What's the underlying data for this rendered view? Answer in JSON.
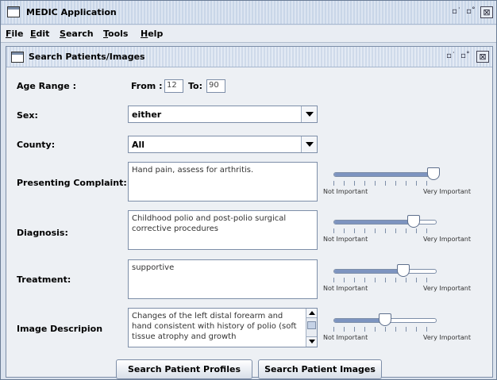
{
  "app": {
    "title": "MEDIC Application"
  },
  "menu": {
    "file": {
      "u": "F",
      "rest": "ile"
    },
    "edit": {
      "u": "E",
      "rest": "dit"
    },
    "search": {
      "u": "S",
      "rest": "earch"
    },
    "tools": {
      "u": "T",
      "rest": "ools"
    },
    "help": {
      "u": "H",
      "rest": "elp"
    }
  },
  "window": {
    "title": "Search Patients/Images",
    "controls": {
      "min": "▫˙",
      "max": "▫˚",
      "close": "⊠"
    }
  },
  "form": {
    "age": {
      "label": "Age Range :",
      "from_label": "From :",
      "from_value": "12",
      "to_label": "To:",
      "to_value": "90"
    },
    "sex": {
      "label": "Sex:",
      "value": "either"
    },
    "county": {
      "label": "County:",
      "value": "All"
    },
    "complaint": {
      "label": "Presenting Complaint:",
      "value": "Hand pain, assess for arthritis.",
      "importance": 0.97
    },
    "diagnosis": {
      "label": "Diagnosis:",
      "value": "Childhood polio and post-polio surgical corrective procedures",
      "importance": 0.78
    },
    "treatment": {
      "label": "Treatment:",
      "value": "supportive",
      "importance": 0.68
    },
    "image_description": {
      "label": "Image Descripion",
      "value": "Changes of the left distal forearm and hand consistent with history of polio (soft tissue atrophy and growth",
      "importance": 0.5
    }
  },
  "slider_labels": {
    "low": "Not Important",
    "high": "Very Important"
  },
  "buttons": {
    "search_profiles": "Search Patient Profiles",
    "search_images": "Search Patient Images"
  }
}
